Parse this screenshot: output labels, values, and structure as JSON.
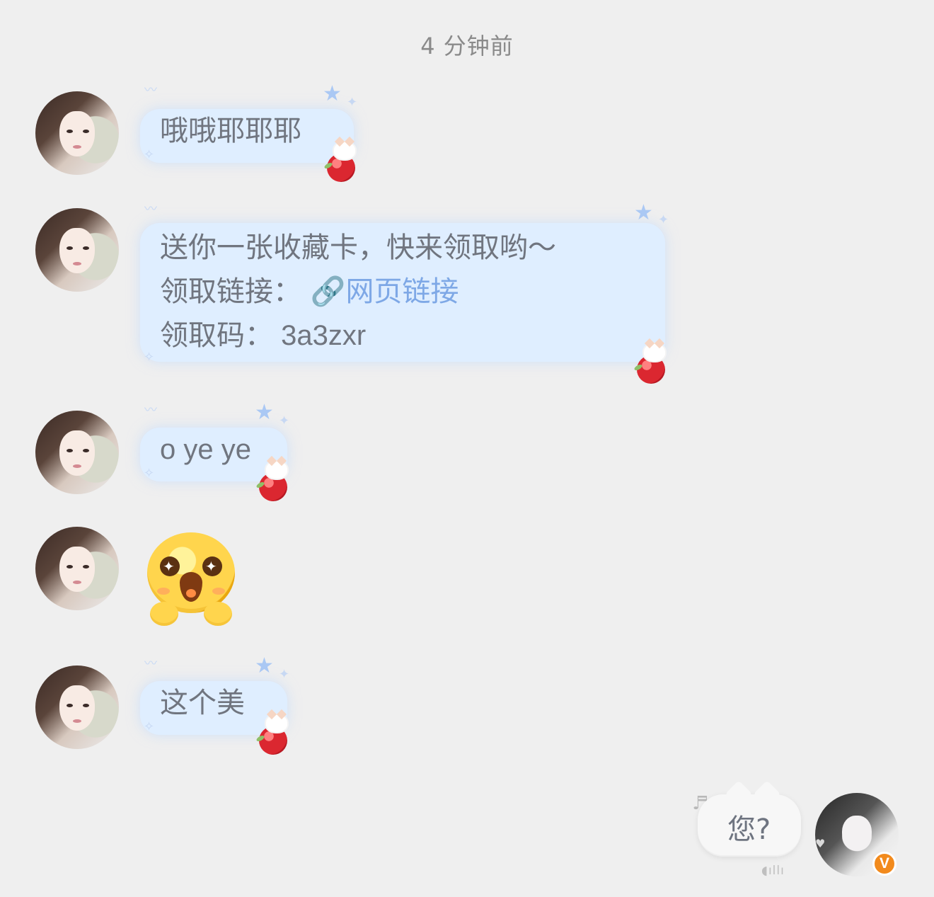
{
  "header": {
    "timestamp": "4 分钟前"
  },
  "messages": [
    {
      "text": "哦哦耶耶耶"
    },
    {
      "line1": "送你一张收藏卡，快来领取哟～",
      "line2_label": "领取链接：",
      "line2_link": "网页链接",
      "line3": "领取码：  3a3zxr"
    },
    {
      "text": "o ye ye"
    },
    {
      "emoji": "star-eyes-emoji"
    },
    {
      "text": "这个美"
    }
  ],
  "self_message": {
    "text": "您?"
  },
  "badge": {
    "label": "V"
  },
  "icons": {
    "avatar": "avatar",
    "link": "link-icon",
    "music": "music-icon",
    "wave": "audio-wave-icon",
    "heart": "heart-icon"
  },
  "colors": {
    "background": "#efefef",
    "bubble": "#dfeeff",
    "link": "#7ea8e6",
    "badge": "#f28a1c"
  }
}
